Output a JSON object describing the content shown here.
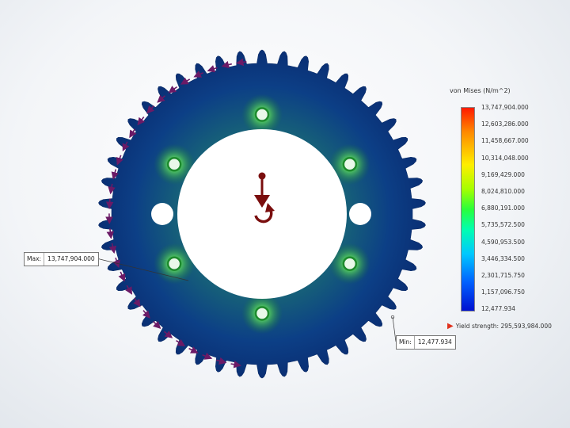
{
  "legend": {
    "title": "von Mises (N/m^2)",
    "ticks": [
      "13,747,904.000",
      "12,603,286.000",
      "11,458,667.000",
      "10,314,048.000",
      "9,169,429.000",
      "8,024,810.000",
      "6,880,191.000",
      "5,735,572.500",
      "4,590,953.500",
      "3,446,334.500",
      "2,301,715.750",
      "1,157,096.750",
      "12,477.934"
    ],
    "yield_label": "Yield strength: 295,593,984.000"
  },
  "callouts": {
    "max": {
      "label": "Max:",
      "value": "13,747,904.000"
    },
    "min": {
      "label": "Min:",
      "value": "12,477.934"
    }
  },
  "colors": {
    "part_base": "#0a3d8a",
    "part_edge": "#082a66",
    "stress_high": "#2cc43a",
    "load_arrow": "#6b1a66",
    "fixture": "#7a0e0e"
  },
  "part": {
    "teeth": 46,
    "bolt_holes": 6
  }
}
